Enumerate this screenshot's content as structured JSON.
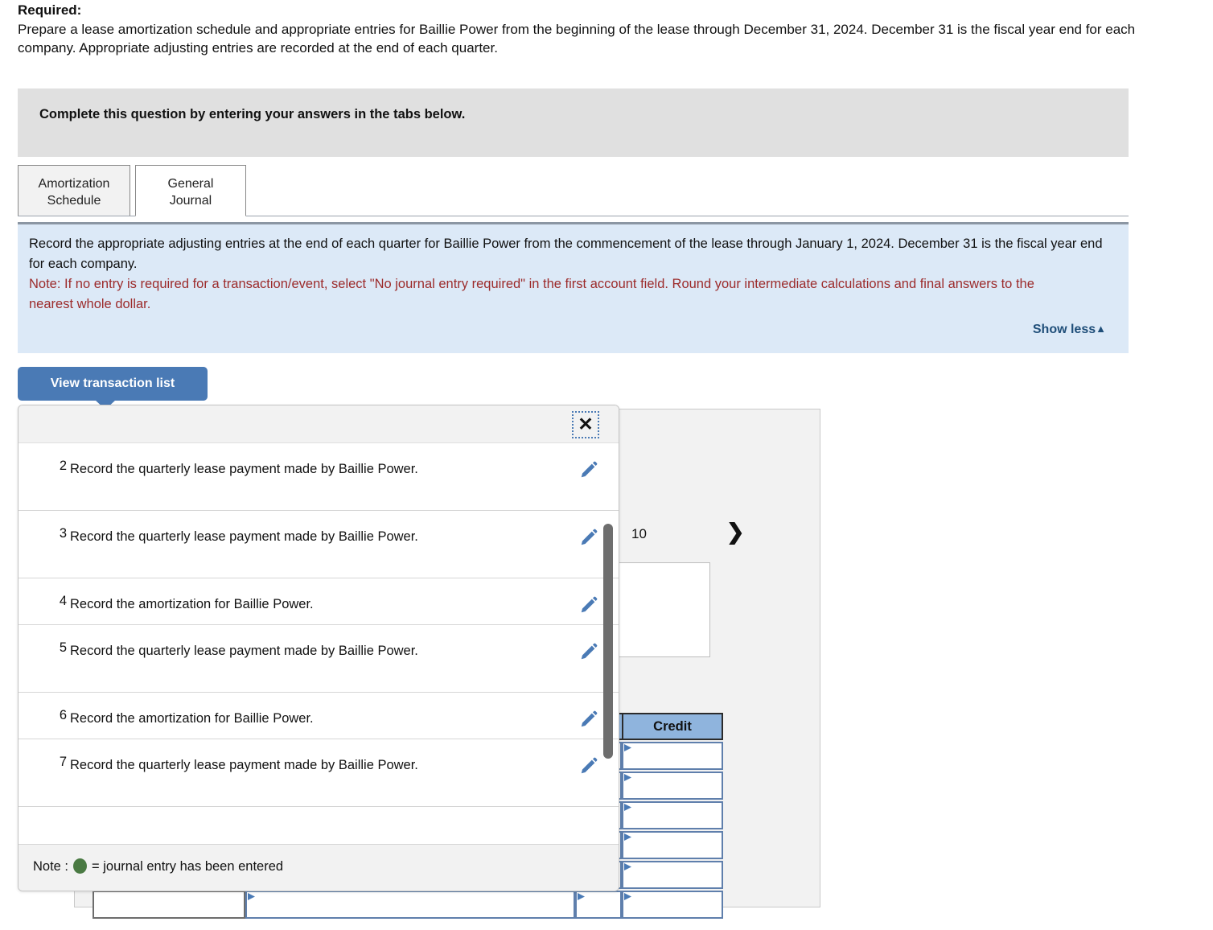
{
  "required": {
    "heading": "Required:",
    "body": "Prepare a lease amortization schedule and appropriate entries for Baillie Power from the beginning of the lease through December 31, 2024. December 31 is the fiscal year end for each company. Appropriate adjusting entries are recorded at the end of each quarter."
  },
  "banner": {
    "text": "Complete this question by entering your answers in the tabs below."
  },
  "tabs": [
    {
      "label_line1": "Amortization",
      "label_line2": "Schedule",
      "active": false
    },
    {
      "label_line1": "General",
      "label_line2": "Journal",
      "active": true
    }
  ],
  "instructions": {
    "main": "Record the appropriate adjusting  entries at the end of each quarter for Baillie Power from the commencement of the lease through January 1, 2024. December 31 is the fiscal year end for each company.",
    "note": "Note: If no entry is required for a transaction/event, select \"No journal entry required\" in the first account field. Round your intermediate calculations and final answers to the nearest whole dollar.",
    "show_less_label": "Show less",
    "show_less_caret": "▲",
    "note_color": "#9c2b2b",
    "panel_color": "#dce9f7"
  },
  "view_transaction_button": {
    "label": "View transaction list",
    "color": "#4a7ab5"
  },
  "popup": {
    "close_icon": "✕",
    "transactions": [
      {
        "num": "2",
        "desc": "Record the quarterly lease payment made by Baillie Power."
      },
      {
        "num": "3",
        "desc": "Record the quarterly lease payment made by Baillie Power."
      },
      {
        "num": "4",
        "desc": "Record the amortization for Baillie Power."
      },
      {
        "num": "5",
        "desc": "Record the quarterly lease payment made by Baillie Power."
      },
      {
        "num": "6",
        "desc": "Record the amortization for Baillie Power."
      },
      {
        "num": "7",
        "desc": "Record the quarterly lease payment made by Baillie Power."
      }
    ],
    "footer": {
      "note_prefix": "Note :",
      "note_suffix": "= journal entry has been entered",
      "dot_color": "#4a7a43"
    }
  },
  "journal_panel": {
    "pager": {
      "prev_icon": "‹",
      "page_number": "10",
      "next_icon": "❯"
    },
    "grid": {
      "headers": [
        "",
        "Credit"
      ],
      "header_color": "#8fb4dd",
      "row_count": 6
    }
  }
}
